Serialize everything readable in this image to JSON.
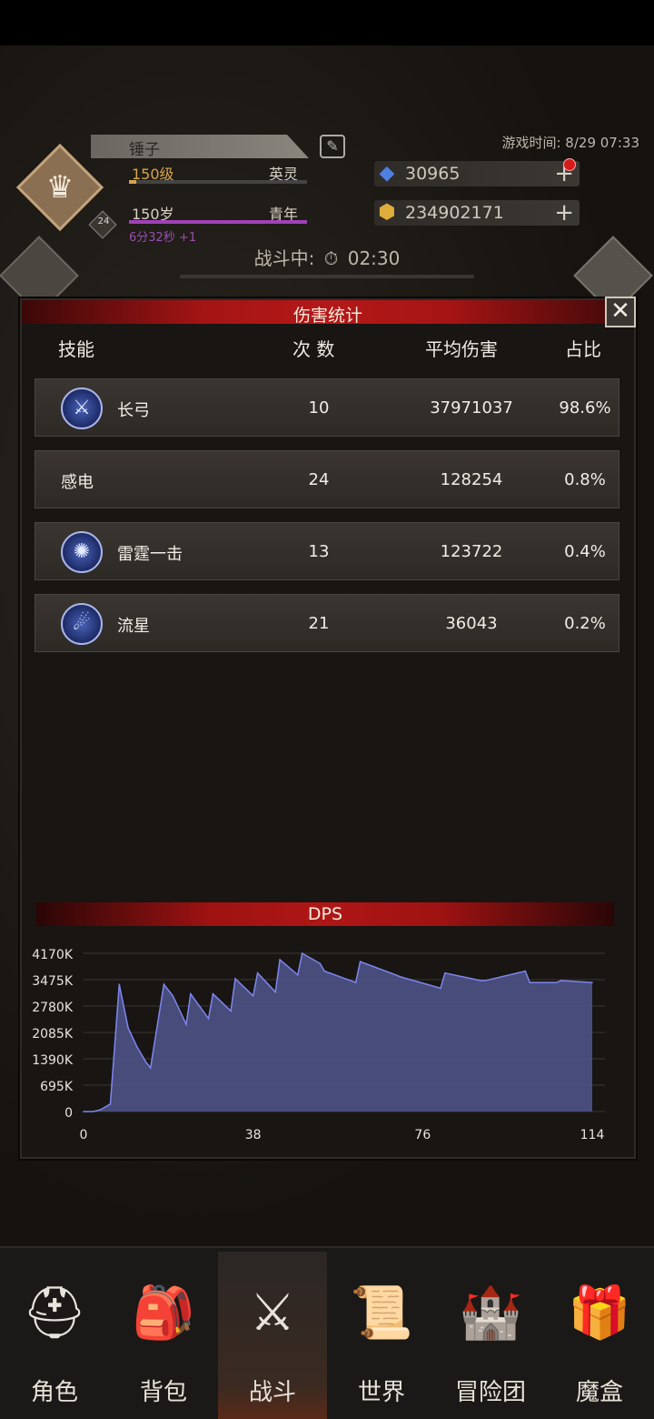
{
  "colors": {
    "accent_red": "#b01616",
    "chart_fill": "#4d5184",
    "chart_stroke": "#7e86f0",
    "level_gold": "#d6a54a",
    "age_purple": "#a041b8"
  },
  "player": {
    "name": "锤子",
    "level": "150级",
    "level_rank": "英灵",
    "level_progress": 0.04,
    "age": "150岁",
    "age_rank": "青年",
    "age_timer": "6分32秒 +1",
    "badge_number": "24"
  },
  "resources": {
    "game_time": "游戏时间: 8/29 07:33",
    "gems": "30965",
    "gold": "234902171",
    "plus": "+"
  },
  "battle": {
    "status": "战斗中:",
    "timer": "02:30"
  },
  "dialog": {
    "title": "伤害统计",
    "close_label": "✕",
    "headers": {
      "skill": "技能",
      "count": "次 数",
      "avg": "平均伤害",
      "pct": "占比"
    },
    "rows": [
      {
        "name": "长弓",
        "count": "10",
        "avg": "37971037",
        "pct": "98.6%",
        "icon": "sword-icon"
      },
      {
        "name": "感电",
        "count": "24",
        "avg": "128254",
        "pct": "0.8%",
        "icon": ""
      },
      {
        "name": "雷霆一击",
        "count": "13",
        "avg": "123722",
        "pct": "0.4%",
        "icon": "thunder-orb-icon"
      },
      {
        "name": "流星",
        "count": "21",
        "avg": "36043",
        "pct": "0.2%",
        "icon": "meteor-icon"
      }
    ],
    "dps_title": "DPS"
  },
  "chart_data": {
    "type": "area",
    "title": "DPS",
    "xlabel": "",
    "ylabel": "",
    "x_ticks": [
      "0",
      "38",
      "76",
      "114"
    ],
    "y_ticks": [
      "4170K",
      "3475K",
      "2780K",
      "2085K",
      "1390K",
      "695K",
      "0"
    ],
    "xlim": [
      0,
      114
    ],
    "ylim": [
      0,
      4170
    ],
    "grid": true,
    "x": [
      0,
      2,
      3,
      4,
      6,
      8,
      10,
      12,
      14,
      15,
      18,
      20,
      23,
      24,
      28,
      29,
      33,
      34,
      38,
      39,
      43,
      44,
      48,
      49,
      53,
      54,
      61,
      62,
      70,
      71,
      80,
      81,
      89,
      90,
      99,
      100,
      106,
      107,
      114
    ],
    "y": [
      0,
      0,
      20,
      60,
      200,
      3350,
      2200,
      1700,
      1300,
      1150,
      3350,
      3050,
      2300,
      3100,
      2450,
      3100,
      2650,
      3500,
      3050,
      3650,
      3150,
      4000,
      3600,
      4170,
      3900,
      3700,
      3400,
      3950,
      3600,
      3550,
      3250,
      3650,
      3450,
      3450,
      3700,
      3400,
      3400,
      3450,
      3400
    ]
  },
  "nav": {
    "items": [
      {
        "label": "角色",
        "icon": "helmet-icon"
      },
      {
        "label": "背包",
        "icon": "backpack-icon"
      },
      {
        "label": "战斗",
        "icon": "sword-shield-icon"
      },
      {
        "label": "世界",
        "icon": "scroll-map-icon"
      },
      {
        "label": "冒险团",
        "icon": "castle-icon"
      },
      {
        "label": "魔盒",
        "icon": "magic-box-icon"
      }
    ]
  }
}
